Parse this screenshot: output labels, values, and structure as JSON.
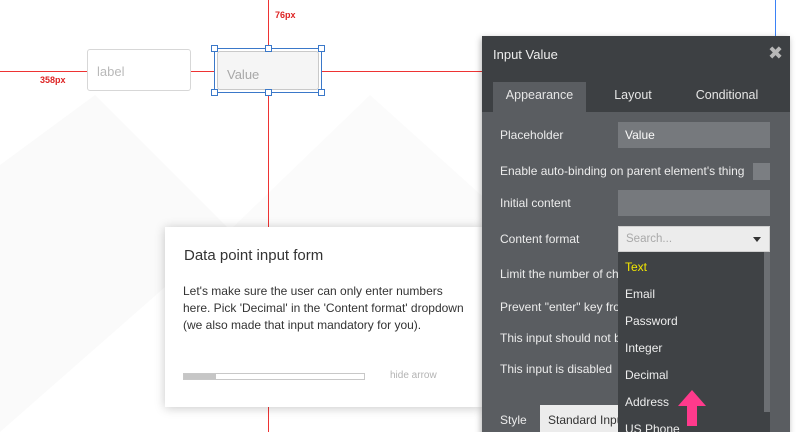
{
  "canvas": {
    "guide_top_label": "76px",
    "guide_left_label": "358px",
    "label_element_text": "label",
    "input_element_placeholder": "Value"
  },
  "tour": {
    "title": "Data point input form",
    "body": "Let's make sure the user can only enter numbers here. Pick 'Decimal' in the 'Content format' dropdown (we also made that input mandatory for you).",
    "progress": 0.18,
    "hide_label": "hide arrow"
  },
  "panel": {
    "title": "Input Value",
    "close_icon": "close-icon",
    "tabs": [
      {
        "label": "Appearance",
        "active": true
      },
      {
        "label": "Layout",
        "active": false
      },
      {
        "label": "Conditional",
        "active": false
      }
    ],
    "placeholder_label": "Placeholder",
    "placeholder_value": "Value",
    "auto_binding_label": "Enable auto-binding on parent element's thing",
    "initial_content_label": "Initial content",
    "initial_content_value": "",
    "content_format_label": "Content format",
    "content_format_search_placeholder": "Search...",
    "limit_label": "Limit the number of cha",
    "prevent_enter_label": "Prevent \"enter\" key from",
    "not_be_label": "This input should not be",
    "disabled_label": "This input is disabled",
    "style_label": "Style",
    "style_value": "Standard Input",
    "content_format_options": [
      "Text",
      "Email",
      "Password",
      "Integer",
      "Decimal",
      "Address",
      "US Phone"
    ],
    "selected_option": "Text",
    "colors": {
      "panel_bg": "#5a5d61",
      "header_bg": "#3d4043",
      "selected_option": "#f2e600",
      "arrow": "#ff3a8c",
      "guide": "#e33333"
    }
  }
}
